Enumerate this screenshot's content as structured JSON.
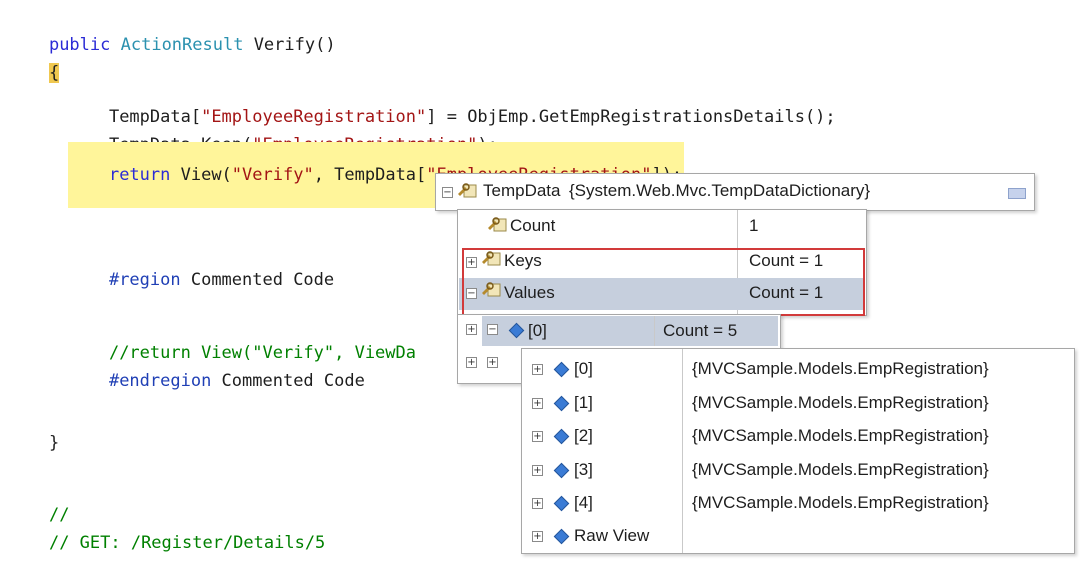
{
  "code": {
    "l1_kw": "public",
    "l1_type": "ActionResult",
    "l1_rest": " Verify()",
    "l2": "{",
    "l3_a": "TempData[",
    "l3_str": "\"EmployeeRegistration\"",
    "l3_b": "] = ObjEmp.GetEmpRegistrationsDetails();",
    "l4_a": "TempData.Keep(",
    "l4_str": "\"EmployeeRegistration\"",
    "l4_b": ");",
    "l5_kw": "return",
    "l5_a": " View(",
    "l5_str1": "\"Verify\"",
    "l5_b": ", TempData[",
    "l5_str2": "\"EmployeeRegistration\"",
    "l5_c": "]);",
    "l6_kw": "#region",
    "l6_rest": " Commented Code",
    "l7": "//return View(\"Verify\", ViewDa",
    "l8_kw": "#endregion",
    "l8_rest": " Commented Code",
    "l9": "}",
    "l10": "//",
    "l11": "// GET: /Register/Details/5"
  },
  "datatip": {
    "root_name": "TempData",
    "root_value": "{System.Web.Mvc.TempDataDictionary}",
    "count_name": "Count",
    "count_value": "1",
    "keys_name": "Keys",
    "keys_value": "Count = 1",
    "values_name": "Values",
    "values_value": "Count = 1",
    "item0_name": "[0]",
    "item0_value": "Count = 5",
    "children": [
      {
        "name": "[0]",
        "value": "{MVCSample.Models.EmpRegistration}"
      },
      {
        "name": "[1]",
        "value": "{MVCSample.Models.EmpRegistration}"
      },
      {
        "name": "[2]",
        "value": "{MVCSample.Models.EmpRegistration}"
      },
      {
        "name": "[3]",
        "value": "{MVCSample.Models.EmpRegistration}"
      },
      {
        "name": "[4]",
        "value": "{MVCSample.Models.EmpRegistration}"
      }
    ],
    "raw_view": "Raw View"
  },
  "colors": {
    "highlight": "#fff59a",
    "selection": "#c6cfdd",
    "annotation": "#d23a3a"
  }
}
